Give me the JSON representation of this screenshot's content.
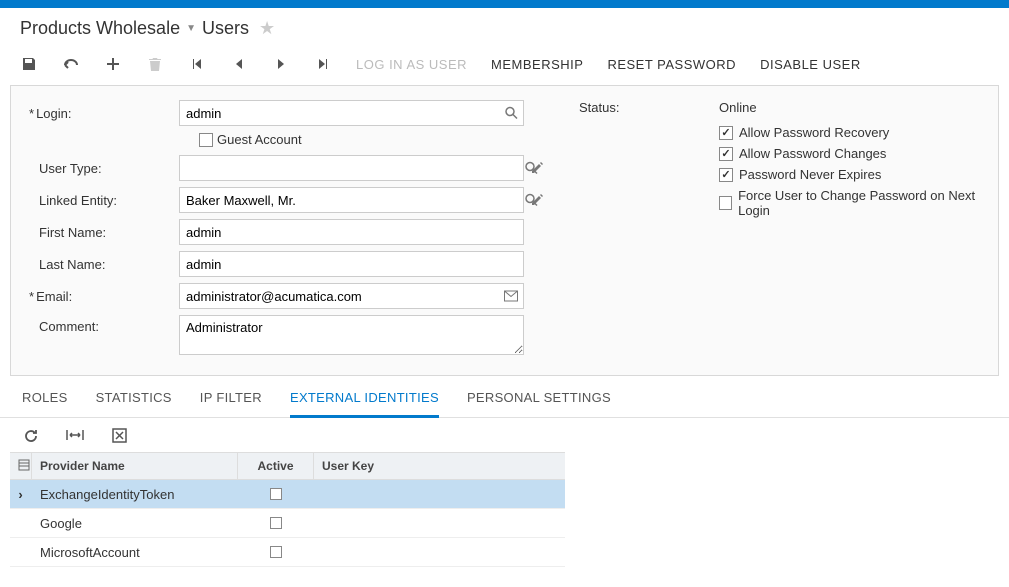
{
  "breadcrumb": {
    "company": "Products Wholesale",
    "screen": "Users"
  },
  "toolbar": {
    "login_as_user": "LOG IN AS USER",
    "membership": "MEMBERSHIP",
    "reset_password": "RESET PASSWORD",
    "disable_user": "DISABLE USER"
  },
  "form": {
    "labels": {
      "login": "Login:",
      "guest": "Guest Account",
      "user_type": "User Type:",
      "linked_entity": "Linked Entity:",
      "first_name": "First Name:",
      "last_name": "Last Name:",
      "email": "Email:",
      "comment": "Comment:",
      "status": "Status:"
    },
    "values": {
      "login": "admin",
      "user_type": "",
      "linked_entity": "Baker Maxwell, Mr.",
      "first_name": "admin",
      "last_name": "admin",
      "email": "administrator@acumatica.com",
      "comment": "Administrator",
      "status": "Online"
    },
    "options": {
      "allow_recovery": "Allow Password Recovery",
      "allow_changes": "Allow Password Changes",
      "never_expires": "Password Never Expires",
      "force_change": "Force User to Change Password on Next Login"
    }
  },
  "tabs": {
    "roles": "ROLES",
    "statistics": "STATISTICS",
    "ip_filter": "IP FILTER",
    "external": "EXTERNAL IDENTITIES",
    "personal": "PERSONAL SETTINGS"
  },
  "grid": {
    "headers": {
      "provider": "Provider Name",
      "active": "Active",
      "userkey": "User Key"
    },
    "rows": [
      {
        "provider": "ExchangeIdentityToken",
        "active": false,
        "selected": true
      },
      {
        "provider": "Google",
        "active": false,
        "selected": false
      },
      {
        "provider": "MicrosoftAccount",
        "active": false,
        "selected": false
      }
    ]
  }
}
